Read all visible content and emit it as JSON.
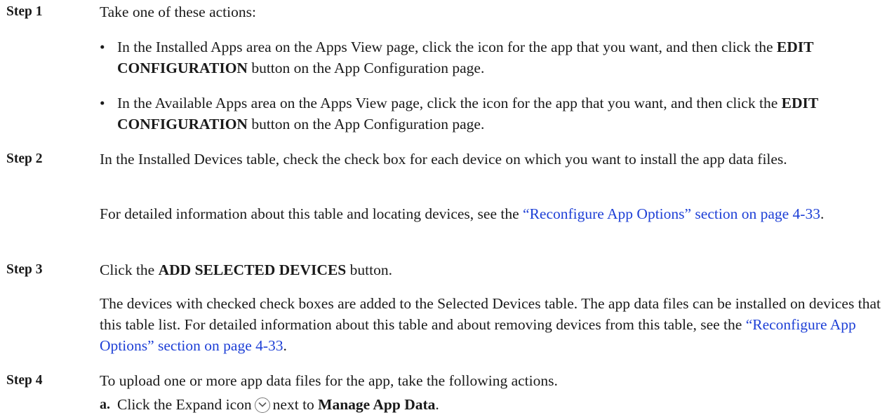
{
  "steps": [
    {
      "label": "Step 1",
      "text": "Take one of these actions:",
      "bullets": [
        {
          "dot": "•",
          "pre": "In the Installed Apps area on the Apps View page, click the icon for the app that you want, and then click the ",
          "bold": "EDIT CONFIGURATION",
          "post": " button on the App Configuration page."
        },
        {
          "dot": "•",
          "pre": "In the Available Apps area on the Apps View page, click the icon for the app that you want, and then click the ",
          "bold": "EDIT CONFIGURATION",
          "post": " button on the App Configuration page."
        }
      ]
    },
    {
      "label": "Step 2",
      "text": "In the Installed Devices table, check the check box for each device on which you want to install the app data files.",
      "para_pre": "For detailed information about this table and locating devices, see the ",
      "para_link": "“Reconfigure App Options” section on page 4-33",
      "para_post": "."
    },
    {
      "label": "Step 3",
      "text_pre": "Click the ",
      "text_bold": "ADD SELECTED DEVICES",
      "text_post": " button.",
      "para_pre": "The devices with checked check boxes are added to the Selected Devices table. The app data files can be installed on devices that this table list. For detailed information about this table and about removing devices from this table, see the ",
      "para_link": "“Reconfigure App Options” section on page 4-33",
      "para_post": "."
    },
    {
      "label": "Step 4",
      "text": "To upload one or more app data files for the app, take the following actions.",
      "sub": {
        "label": "a.",
        "pre": "Click the Expand icon",
        "icon": "expand-chevron-icon",
        "mid": "next to ",
        "bold": "Manage App Data",
        "post": "."
      }
    }
  ]
}
